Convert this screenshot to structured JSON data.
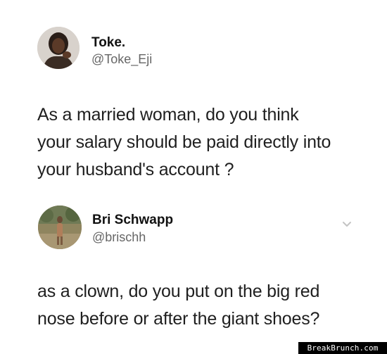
{
  "tweets": [
    {
      "name": "Toke.",
      "handle": "@Toke_Eji",
      "avatar": "profile-photo-woman",
      "text_lines": [
        "As a married woman, do you think",
        "your salary should be paid directly into",
        "your husband's account ?"
      ]
    },
    {
      "name": "Bri Schwapp",
      "handle": "@brischh",
      "avatar": "profile-photo-outdoor",
      "menu_icon": "chevron-down-icon",
      "text_lines": [
        "as a clown, do you put on the big red",
        "nose before or after the giant shoes?"
      ]
    }
  ],
  "watermark": "BreakBrunch.com",
  "colors": {
    "name": "#111111",
    "handle": "#666666",
    "body": "#1f1f1f",
    "chevron": "#c4c4c4"
  }
}
